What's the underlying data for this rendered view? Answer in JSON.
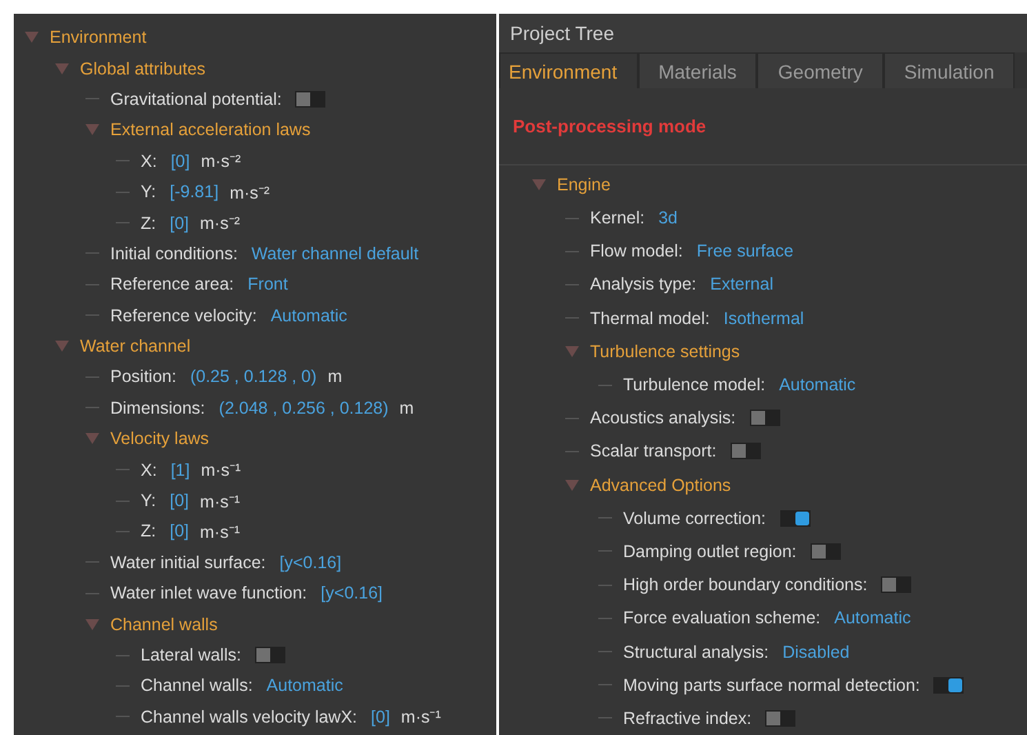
{
  "left_tree": [
    {
      "kind": "group",
      "label": "Environment",
      "expanded": true,
      "children": [
        {
          "kind": "group",
          "label": "Global attributes",
          "expanded": true,
          "children": [
            {
              "kind": "toggle",
              "label": "Gravitational potential:",
              "on": false
            },
            {
              "kind": "group",
              "label": "External acceleration laws",
              "expanded": true,
              "children": [
                {
                  "kind": "value",
                  "label": "X:",
                  "value": "[0]",
                  "unit": "m·s⁻²"
                },
                {
                  "kind": "value",
                  "label": "Y:",
                  "value": "[-9.81]",
                  "unit": "m·s⁻²"
                },
                {
                  "kind": "value",
                  "label": "Z:",
                  "value": "[0]",
                  "unit": "m·s⁻²"
                }
              ]
            },
            {
              "kind": "value",
              "label": "Initial conditions:",
              "value": "Water channel default"
            },
            {
              "kind": "value",
              "label": "Reference area:",
              "value": "Front"
            },
            {
              "kind": "value",
              "label": "Reference velocity:",
              "value": "Automatic"
            }
          ]
        },
        {
          "kind": "group",
          "label": "Water channel",
          "expanded": true,
          "children": [
            {
              "kind": "value",
              "label": "Position:",
              "value": "(0.25 , 0.128 , 0)",
              "unit": "m"
            },
            {
              "kind": "value",
              "label": "Dimensions:",
              "value": "(2.048 , 0.256 , 0.128)",
              "unit": "m"
            },
            {
              "kind": "group",
              "label": "Velocity laws",
              "expanded": true,
              "children": [
                {
                  "kind": "value",
                  "label": "X:",
                  "value": "[1]",
                  "unit": "m·s⁻¹"
                },
                {
                  "kind": "value",
                  "label": "Y:",
                  "value": "[0]",
                  "unit": "m·s⁻¹"
                },
                {
                  "kind": "value",
                  "label": "Z:",
                  "value": "[0]",
                  "unit": "m·s⁻¹"
                }
              ]
            },
            {
              "kind": "value",
              "label": "Water initial surface:",
              "value": "[y<0.16]"
            },
            {
              "kind": "value",
              "label": "Water inlet wave function:",
              "value": "[y<0.16]"
            },
            {
              "kind": "group",
              "label": "Channel walls",
              "expanded": true,
              "children": [
                {
                  "kind": "toggle",
                  "label": "Lateral walls:",
                  "on": false
                },
                {
                  "kind": "value",
                  "label": "Channel walls:",
                  "value": "Automatic"
                },
                {
                  "kind": "value",
                  "label": "Channel walls velocity lawX:",
                  "value": "[0]",
                  "unit": "m·s⁻¹"
                }
              ]
            }
          ]
        }
      ]
    }
  ],
  "project_tree": {
    "title": "Project Tree",
    "tabs": [
      {
        "label": "Environment",
        "selected": true
      },
      {
        "label": "Materials",
        "selected": false
      },
      {
        "label": "Geometry",
        "selected": false
      },
      {
        "label": "Simulation",
        "selected": false
      }
    ],
    "mode_label": "Post-processing mode",
    "tree": [
      {
        "kind": "group",
        "label": "Engine",
        "expanded": true,
        "children": [
          {
            "kind": "value",
            "label": "Kernel:",
            "value": "3d"
          },
          {
            "kind": "value",
            "label": "Flow model:",
            "value": "Free surface"
          },
          {
            "kind": "value",
            "label": "Analysis type:",
            "value": "External"
          },
          {
            "kind": "value",
            "label": "Thermal model:",
            "value": "Isothermal"
          },
          {
            "kind": "group",
            "label": "Turbulence settings",
            "expanded": true,
            "children": [
              {
                "kind": "value",
                "label": "Turbulence model:",
                "value": "Automatic"
              }
            ]
          },
          {
            "kind": "toggle",
            "label": "Acoustics analysis:",
            "on": false
          },
          {
            "kind": "toggle",
            "label": "Scalar transport:",
            "on": false
          },
          {
            "kind": "group",
            "label": "Advanced Options",
            "expanded": true,
            "children": [
              {
                "kind": "toggle",
                "label": "Volume correction:",
                "on": true
              },
              {
                "kind": "toggle",
                "label": "Damping outlet region:",
                "on": false
              },
              {
                "kind": "toggle",
                "label": "High order boundary conditions:",
                "on": false
              },
              {
                "kind": "value",
                "label": "Force evaluation scheme:",
                "value": "Automatic"
              },
              {
                "kind": "value",
                "label": "Structural analysis:",
                "value": "Disabled"
              },
              {
                "kind": "toggle",
                "label": "Moving parts surface normal detection:",
                "on": true
              },
              {
                "kind": "toggle",
                "label": "Refractive index:",
                "on": false
              }
            ]
          }
        ]
      }
    ]
  }
}
